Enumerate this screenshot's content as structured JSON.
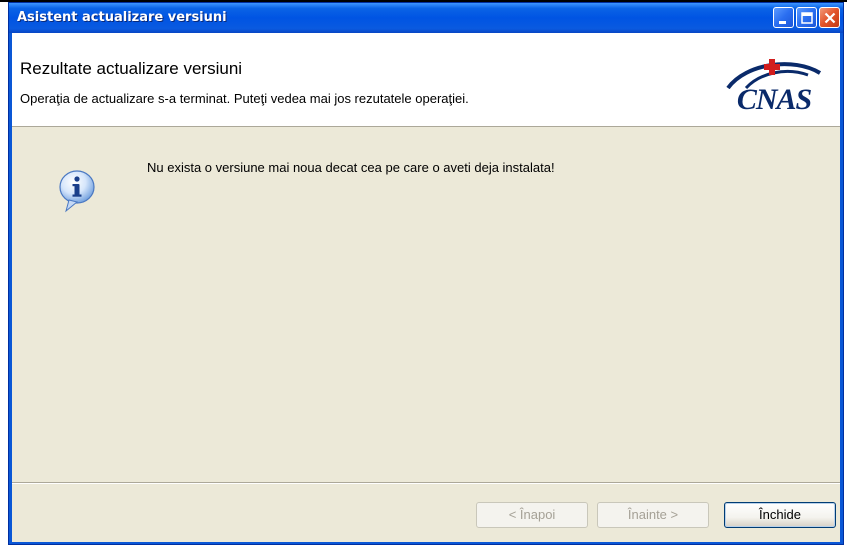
{
  "window": {
    "title": "Asistent actualizare versiuni",
    "controls": {
      "minimize_icon": "minimize-icon",
      "maximize_icon": "maximize-icon",
      "close_icon": "close-icon"
    }
  },
  "header": {
    "title": "Rezultate actualizare versiuni",
    "subtitle": "Operaţia de actualizare s-a terminat. Puteţi vedea mai jos rezutatele operaţiei.",
    "logo_text": "CNAS"
  },
  "content": {
    "icon": "info-icon",
    "message": "Nu exista o versiune mai noua decat cea pe care o aveti deja instalata!"
  },
  "footer": {
    "back_label": "< Înapoi",
    "next_label": "Înainte >",
    "close_label": "Închide"
  },
  "colors": {
    "titlebar": "#0054e3",
    "dialog_bg": "#ece9d8",
    "header_bg": "#ffffff",
    "logo": "#0a2a6a",
    "logo_accent": "#d21e1e"
  }
}
